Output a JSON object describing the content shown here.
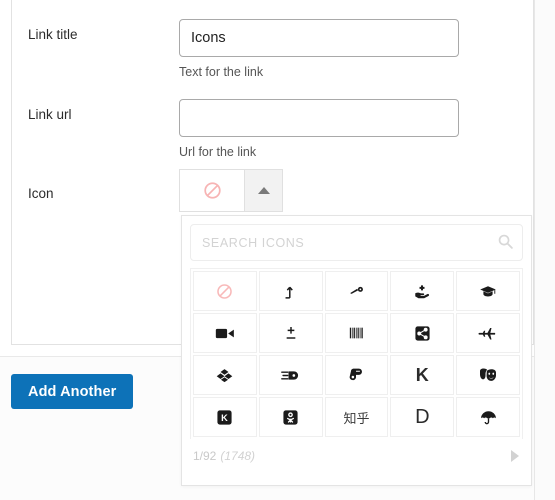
{
  "form": {
    "fields": [
      {
        "label": "Link title",
        "value": "Icons",
        "placeholder": "",
        "help": "Text for the link",
        "name": "link-title"
      },
      {
        "label": "Link url",
        "value": "",
        "placeholder": "",
        "help": "Url for the link",
        "name": "link-url"
      }
    ],
    "icon_field": {
      "label": "Icon",
      "selected_icon": "ban-icon",
      "toggle_icon": "caret-up-icon"
    },
    "add_another_label": "Add Another"
  },
  "icon_picker": {
    "search": {
      "placeholder": "SEARCH ICONS",
      "value": "",
      "icon": "search-icon"
    },
    "rows": [
      [
        {
          "name": "ban-icon",
          "glyph": "",
          "selected": true
        },
        {
          "name": "level-up-alt-icon",
          "glyph": "",
          "selected": false
        },
        {
          "name": "faucet-icon",
          "glyph": "",
          "selected": false
        },
        {
          "name": "hand-holding-medical-icon",
          "glyph": "",
          "selected": false
        },
        {
          "name": "graduation-cap-icon",
          "glyph": "",
          "selected": false
        }
      ],
      [
        {
          "name": "video-icon",
          "glyph": "",
          "selected": false
        },
        {
          "name": "plus-minus-icon",
          "glyph": "",
          "selected": false
        },
        {
          "name": "barcode-icon",
          "glyph": "",
          "selected": false
        },
        {
          "name": "share-alt-square-icon",
          "glyph": "",
          "selected": false
        },
        {
          "name": "fighter-jet-icon",
          "glyph": "",
          "selected": false
        }
      ],
      [
        {
          "name": "dropbox-icon",
          "glyph": "",
          "selected": false
        },
        {
          "name": "hand-point-right-fast-icon",
          "glyph": "",
          "selected": false
        },
        {
          "name": "hand-point-down-icon",
          "glyph": "",
          "selected": false
        },
        {
          "name": "kickstarter-k-icon",
          "glyph": "K",
          "selected": false
        },
        {
          "name": "theater-masks-icon",
          "glyph": "",
          "selected": false
        }
      ],
      [
        {
          "name": "kickstarter-icon",
          "glyph": "K",
          "selected": false
        },
        {
          "name": "odnoklassniki-square-icon",
          "glyph": "",
          "selected": false
        },
        {
          "name": "zhihu-icon",
          "glyph": "知乎",
          "selected": false
        },
        {
          "name": "digital-ocean-icon",
          "glyph": "D",
          "selected": false
        },
        {
          "name": "umbrella-icon",
          "glyph": "",
          "selected": false
        }
      ]
    ],
    "footer": {
      "page": "1/92",
      "total": "(1748)",
      "next_icon": "caret-right-icon"
    }
  },
  "colors": {
    "accent": "#0d72b8",
    "ban": "#f8b9b9",
    "muted": "#c9c9c9"
  }
}
